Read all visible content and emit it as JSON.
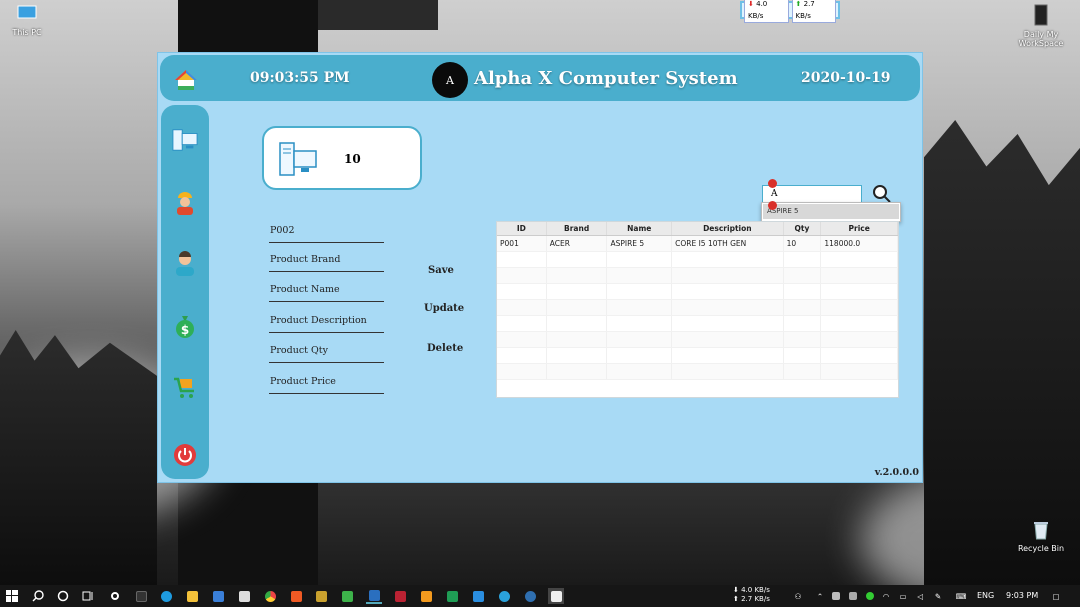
{
  "desktop": {
    "icons": [
      {
        "label": "This PC"
      },
      {
        "label": "Daily My WorkSpace"
      },
      {
        "label": "Recycle Bin"
      }
    ]
  },
  "net_meter": {
    "down": "4.0 KB/s",
    "up": "2.7 KB/s"
  },
  "app": {
    "time": "09:03:55 PM",
    "title": "Alpha X Computer System",
    "logo_text": "A",
    "date": "2020-10-19",
    "product_count": "10",
    "form": {
      "id_value": "P002",
      "brand_placeholder": "Product Brand",
      "name_placeholder": "Product Name",
      "description_placeholder": "Product Description",
      "qty_placeholder": "Product Qty",
      "price_placeholder": "Product Price"
    },
    "actions": {
      "save": "Save",
      "update": "Update",
      "delete": "Delete"
    },
    "search": {
      "value": "A",
      "suggestion": "ASPIRE 5"
    },
    "table": {
      "headers": [
        "ID",
        "Brand",
        "Name",
        "Description",
        "Qty",
        "Price"
      ],
      "rows": [
        [
          "P001",
          "ACER",
          "ASPIRE 5",
          "CORE I5 10TH GEN",
          "10",
          "118000.0"
        ]
      ]
    },
    "version": "v.2.0.0.0",
    "colors": {
      "panel": "#a8daf5",
      "accent": "#4aaecd",
      "power": "#e23b3b"
    }
  },
  "taskbar": {
    "speed_down": "4.0 KB/s",
    "speed_up": "2.7 KB/s",
    "language": "ENG",
    "clock": "9:03 PM"
  }
}
